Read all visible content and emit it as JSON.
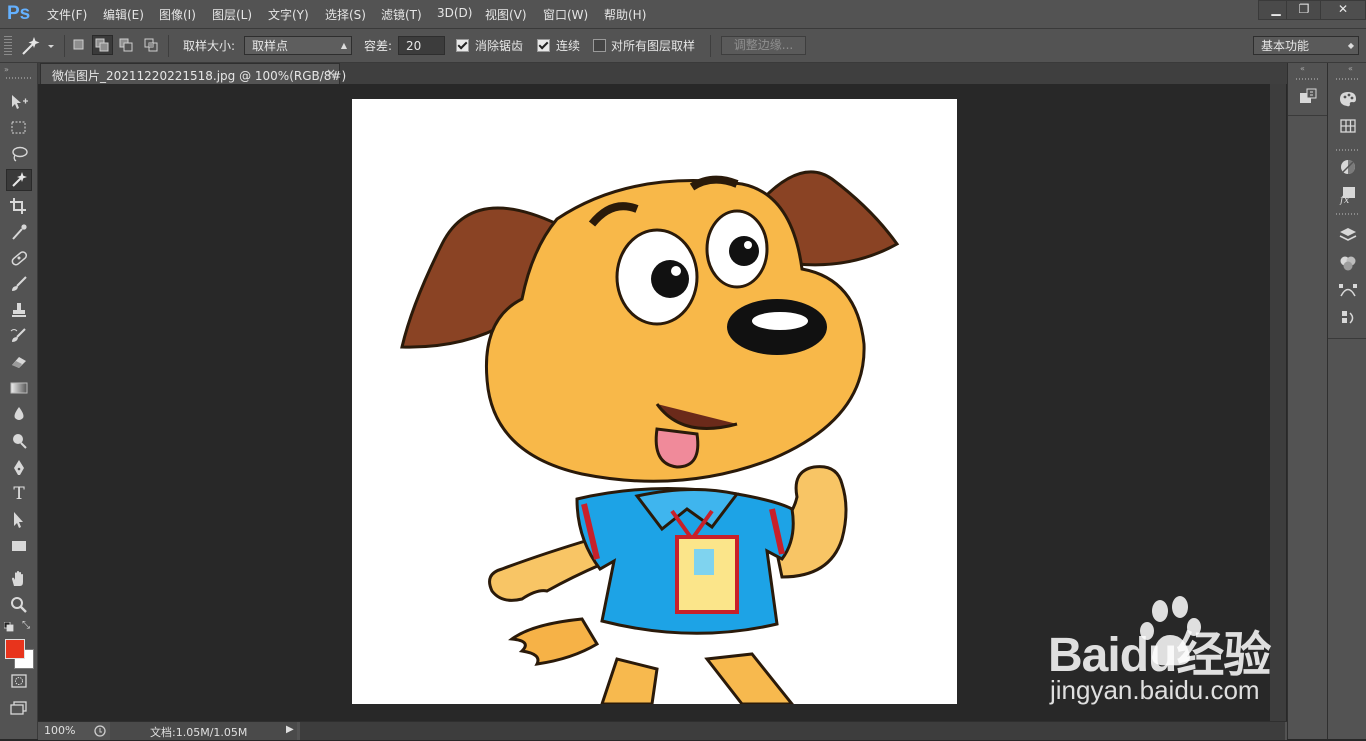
{
  "app": {
    "logo": "Ps"
  },
  "menu": [
    "文件(F)",
    "编辑(E)",
    "图像(I)",
    "图层(L)",
    "文字(Y)",
    "选择(S)",
    "滤镜(T)",
    "3D(D)",
    "视图(V)",
    "窗口(W)",
    "帮助(H)"
  ],
  "window_controls": {
    "minimize": "▁",
    "restore": "❐",
    "close": "✕"
  },
  "options": {
    "sample_size_label": "取样大小:",
    "sample_size_value": "取样点",
    "tolerance_label": "容差:",
    "tolerance_value": "20",
    "antialias_label": "消除锯齿",
    "antialias_checked": true,
    "contiguous_label": "连续",
    "contiguous_checked": true,
    "sample_all_layers_label": "对所有图层取样",
    "sample_all_layers_checked": false,
    "refine_edge_label": "调整边缘...",
    "workspace_value": "基本功能"
  },
  "document": {
    "tab_title": "微信图片_20211220221518.jpg @ 100%(RGB/8#)",
    "tab_close": "×"
  },
  "status": {
    "zoom": "100%",
    "doc_size": "文档:1.05M/1.05M"
  },
  "tools": [
    {
      "name": "move-tool-icon",
      "glyph": "▸"
    },
    {
      "name": "marquee-tool-icon",
      "glyph": "⬚"
    },
    {
      "name": "lasso-tool-icon",
      "glyph": "◌"
    },
    {
      "name": "magic-wand-tool-icon",
      "glyph": "✷"
    },
    {
      "name": "crop-tool-icon",
      "glyph": "⌗"
    },
    {
      "name": "eyedropper-tool-icon",
      "glyph": "⁄"
    },
    {
      "name": "healing-brush-tool-icon",
      "glyph": "✚"
    },
    {
      "name": "brush-tool-icon",
      "glyph": "✎"
    },
    {
      "name": "stamp-tool-icon",
      "glyph": "⊥"
    },
    {
      "name": "history-brush-tool-icon",
      "glyph": "✐"
    },
    {
      "name": "eraser-tool-icon",
      "glyph": "▱"
    },
    {
      "name": "gradient-tool-icon",
      "glyph": "▬"
    },
    {
      "name": "blur-tool-icon",
      "glyph": "●"
    },
    {
      "name": "dodge-tool-icon",
      "glyph": "●"
    },
    {
      "name": "pen-tool-icon",
      "glyph": "✒"
    },
    {
      "name": "type-tool-icon",
      "glyph": "T"
    },
    {
      "name": "path-selection-tool-icon",
      "glyph": "➤"
    },
    {
      "name": "rectangle-tool-icon",
      "glyph": "■"
    },
    {
      "name": "hand-tool-icon",
      "glyph": "✋"
    },
    {
      "name": "zoom-tool-icon",
      "glyph": "⚲"
    }
  ],
  "colors": {
    "foreground": "#e8341c",
    "background": "#ffffff",
    "accent": "#64b1ff",
    "ui": "#535353",
    "canvas_bg": "#282828"
  },
  "watermark": {
    "brand": "Baidu经验",
    "url": "jingyan.baidu.com"
  }
}
